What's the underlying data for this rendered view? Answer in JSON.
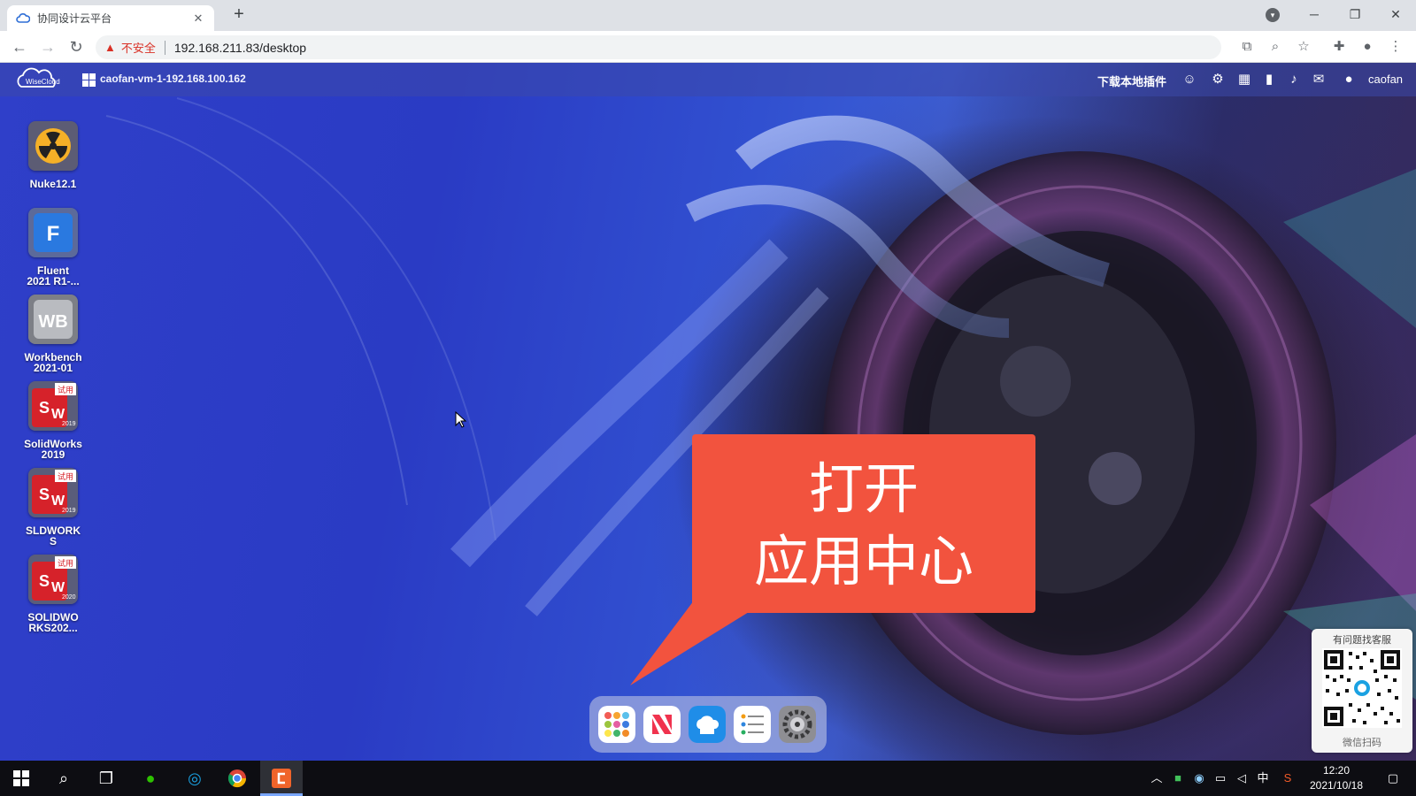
{
  "browser": {
    "tab_title": "协同设计云平台",
    "tab_close": "✕",
    "new_tab": "+",
    "window_controls": {
      "minimize": "─",
      "restore": "❐",
      "close": "✕"
    },
    "security_label": "不安全",
    "url": "192.168.211.83/desktop",
    "icons": [
      "back-icon",
      "forward-icon",
      "reload-icon",
      "translate-icon",
      "zoom-icon",
      "star-icon",
      "extensions-icon",
      "profile-icon",
      "menu-icon"
    ]
  },
  "topbar": {
    "vm_name": "caofan-vm-1-192.168.100.162",
    "download_plugin": "下载本地插件",
    "username": "caofan",
    "icons": [
      "support-icon",
      "user-settings-icon",
      "calendar-icon",
      "signal-icon",
      "bell-icon",
      "wechat-icon",
      "account-icon"
    ]
  },
  "desktop_icons": [
    {
      "label_lines": [
        "Nuke12.1"
      ],
      "icon": "nuke-icon"
    },
    {
      "label_lines": [
        "Fluent",
        "2021 R1-..."
      ],
      "icon": "fluent-icon",
      "glyph": "F"
    },
    {
      "label_lines": [
        "Workbench",
        "2021-01"
      ],
      "icon": "workbench-icon",
      "glyph": "WB"
    },
    {
      "label_lines": [
        "SolidWorks",
        "2019"
      ],
      "icon": "solidworks-icon",
      "badge": "试用",
      "year": "2019"
    },
    {
      "label_lines": [
        "SLDWORK",
        "S"
      ],
      "icon": "solidworks-icon",
      "badge": "试用",
      "year": "2019"
    },
    {
      "label_lines": [
        "SOLIDWO",
        "RKS202..."
      ],
      "icon": "solidworks-icon",
      "badge": "试用",
      "year": "2020"
    }
  ],
  "callout": {
    "line1": "打开",
    "line2": "应用中心"
  },
  "dock": [
    {
      "name": "app-center-icon"
    },
    {
      "name": "news-icon"
    },
    {
      "name": "cloud-drive-icon"
    },
    {
      "name": "task-list-icon"
    },
    {
      "name": "system-settings-icon"
    }
  ],
  "qr": {
    "title": "有问题找客服",
    "footer": "微信扫码"
  },
  "taskbar": {
    "clock_time": "12:20",
    "clock_date": "2021/10/18",
    "ime": "中"
  },
  "colors": {
    "callout": "#f2533e",
    "desktop_blue": "#2f3fc9",
    "taskbar": "#0d0d12"
  }
}
